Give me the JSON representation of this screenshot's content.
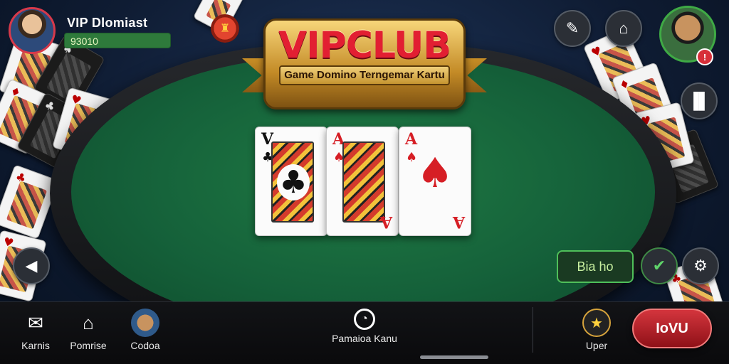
{
  "player": {
    "name": "VIP Dlomiast",
    "chips": "93010"
  },
  "logo": {
    "title": "VIPCLUB",
    "subtitle": "Game Domino Terngemar Kartu"
  },
  "table_cards": [
    {
      "rank": "V",
      "suit": "♣",
      "color": "black"
    },
    {
      "rank": "A",
      "suit": "♠",
      "color": "red"
    },
    {
      "rank": "A",
      "suit": "♠",
      "color": "red"
    }
  ],
  "actions": {
    "green_button": "Bia ho",
    "play_button": "IoVU"
  },
  "bottom_nav": [
    {
      "label": "Karnis",
      "icon": "mail-icon"
    },
    {
      "label": "Pomrise",
      "icon": "shop-icon"
    },
    {
      "label": "Codoa",
      "icon": "avatar-icon"
    },
    {
      "label": "Pamaioa Kanu",
      "icon": "clock-icon"
    },
    {
      "label": "Uper",
      "icon": "trophy-icon"
    }
  ],
  "icons": {
    "edit": "edit-icon",
    "camera": "camera-icon",
    "leaderboard": "chart-icon",
    "back": "back-icon",
    "check": "check-icon",
    "settings": "gear-icon"
  },
  "colors": {
    "felt": "#1f7a43",
    "accent_red": "#d61e25",
    "gold": "#d79b2a"
  }
}
